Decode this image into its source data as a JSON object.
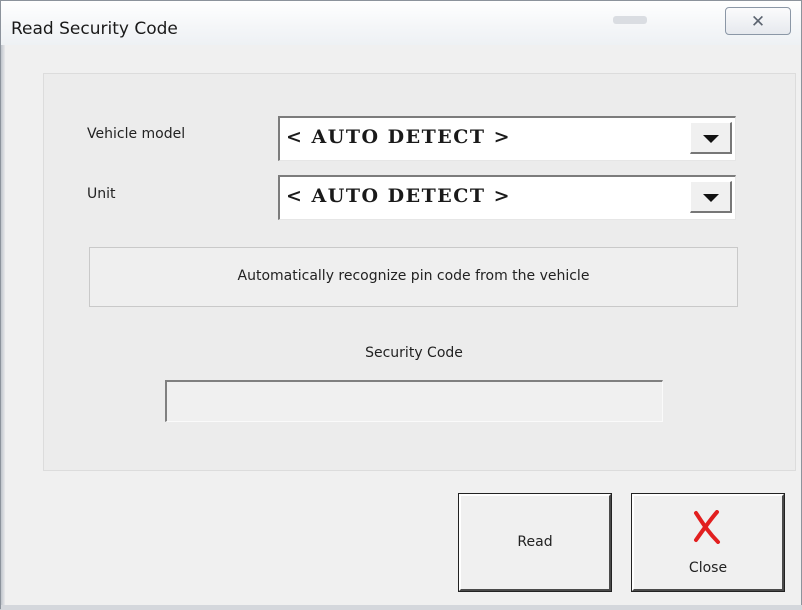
{
  "window": {
    "title": "Read Security Code",
    "close_glyph": "✕",
    "close_icon": "close-icon"
  },
  "form": {
    "vehicle_model": {
      "label": "Vehicle model",
      "value": "< AUTO DETECT >",
      "arrow_icon": "triangle-down-icon"
    },
    "unit": {
      "label": "Unit",
      "value": "< AUTO DETECT >",
      "arrow_icon": "triangle-down-icon"
    },
    "info_text": "Automatically recognize pin code from the vehicle",
    "security_code": {
      "label": "Security Code",
      "value": ""
    }
  },
  "buttons": {
    "read_label": "Read",
    "close_label": "Close",
    "close_icon": "red-x-icon",
    "close_icon_color": "#e21f1f"
  }
}
